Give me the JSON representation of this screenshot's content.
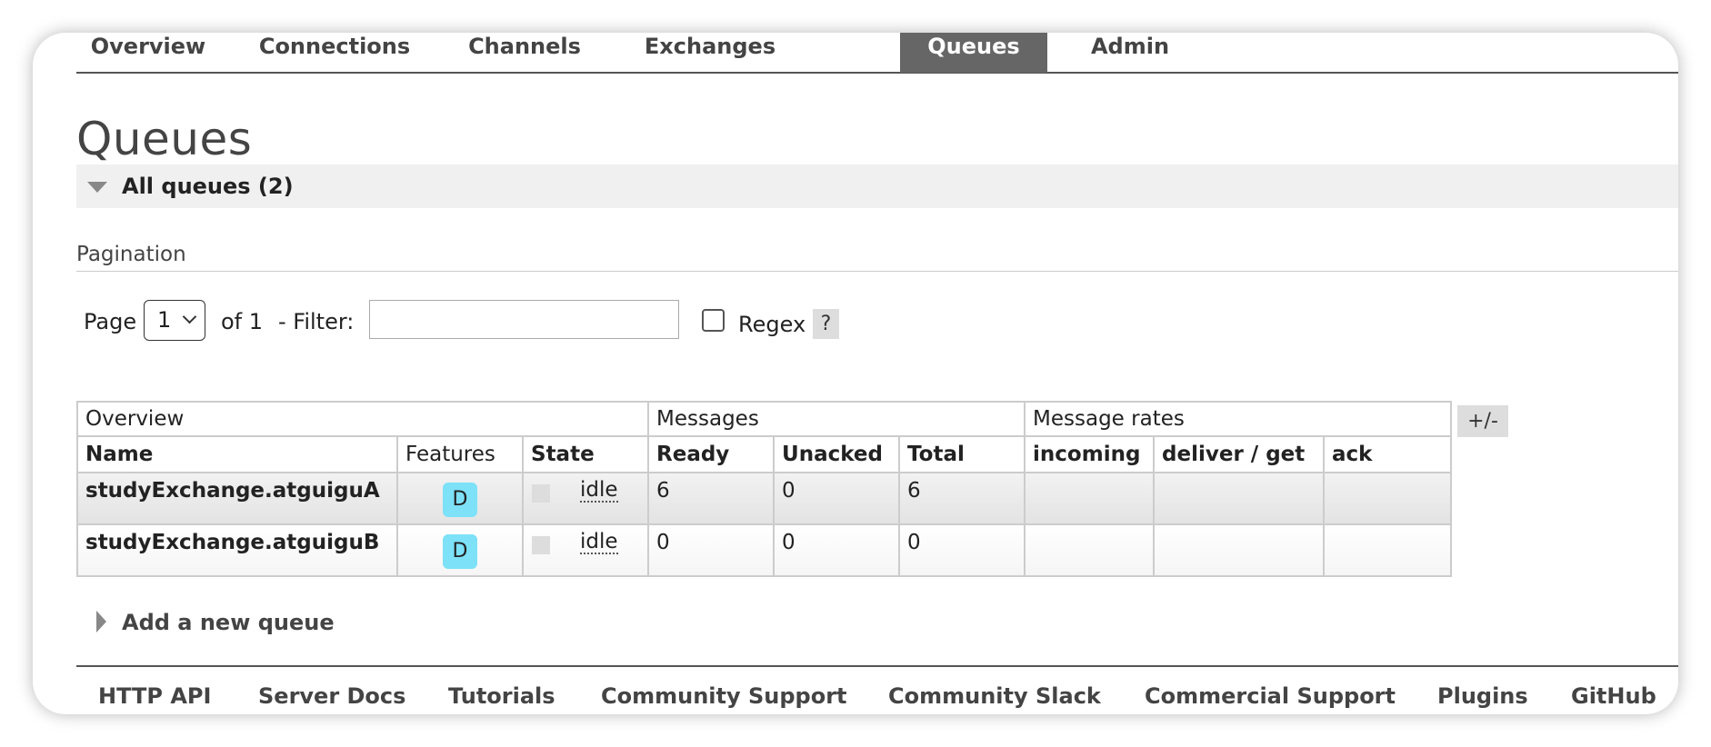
{
  "nav": {
    "items": [
      "Overview",
      "Connections",
      "Channels",
      "Exchanges",
      "Queues",
      "Admin"
    ],
    "active": "Queues"
  },
  "page": {
    "title": "Queues",
    "section_label": "All queues (2)",
    "pagination_label": "Pagination"
  },
  "filter": {
    "page_label": "Page",
    "page_value": "1",
    "of_label": "of 1",
    "filter_label": "- Filter:",
    "filter_value": "",
    "regex_label": "Regex",
    "regex_checked": false,
    "help_label": "?"
  },
  "table": {
    "groups": [
      "Overview",
      "Messages",
      "Message rates"
    ],
    "columns": [
      "Name",
      "Features",
      "State",
      "Ready",
      "Unacked",
      "Total",
      "incoming",
      "deliver / get",
      "ack"
    ],
    "rows": [
      {
        "name": "studyExchange.atguiguA",
        "feature": "D",
        "state": "idle",
        "ready": "6",
        "unacked": "0",
        "total": "6",
        "incoming": "",
        "deliver_get": "",
        "ack": ""
      },
      {
        "name": "studyExchange.atguiguB",
        "feature": "D",
        "state": "idle",
        "ready": "0",
        "unacked": "0",
        "total": "0",
        "incoming": "",
        "deliver_get": "",
        "ack": ""
      }
    ],
    "toggle_label": "+/-"
  },
  "add_queue_label": "Add a new queue",
  "footer": {
    "links": [
      "HTTP API",
      "Server Docs",
      "Tutorials",
      "Community Support",
      "Community Slack",
      "Commercial Support",
      "Plugins",
      "GitHub"
    ]
  },
  "colors": {
    "nav_active_bg": "#666666",
    "feature_badge": "#7de1f8",
    "section_bar": "#f0f0f0"
  }
}
